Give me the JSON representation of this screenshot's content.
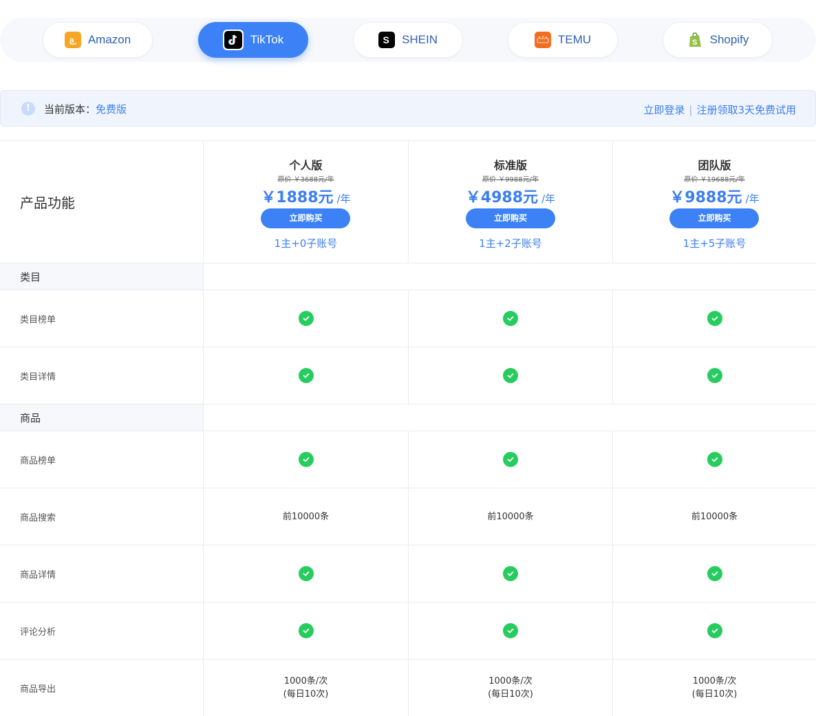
{
  "platform_tabs": [
    {
      "label": "Amazon",
      "active": false,
      "icon": "amazon-logo-icon",
      "color": "#f5a623"
    },
    {
      "label": "TikTok",
      "active": true,
      "icon": "tiktok-logo-icon",
      "color": "#000000"
    },
    {
      "label": "SHEIN",
      "active": false,
      "icon": "shein-logo-icon",
      "color": "#000000"
    },
    {
      "label": "TEMU",
      "active": false,
      "icon": "temu-logo-icon",
      "color": "#f36d21"
    },
    {
      "label": "Shopify",
      "active": false,
      "icon": "shopify-logo-icon",
      "color": "#95bf47"
    }
  ],
  "version_bar": {
    "icon": "info-icon",
    "prefix": "当前版本：",
    "current": "免费版",
    "login_link": "立即登录",
    "separator": "|",
    "trial_link": "注册领取3天免费试用"
  },
  "table": {
    "feature_header": "产品功能",
    "plans": [
      {
        "name": "个人版",
        "original": "原价 ￥3688元/年",
        "price": "￥1888元",
        "unit": "/年",
        "buy": "立即购买",
        "accounts": "1主+0子账号"
      },
      {
        "name": "标准版",
        "original": "原价 ￥9988元/年",
        "price": "￥4988元",
        "unit": "/年",
        "buy": "立即购买",
        "accounts": "1主+2子账号"
      },
      {
        "name": "团队版",
        "original": "原价 ￥19688元/年",
        "price": "￥9888元",
        "unit": "/年",
        "buy": "立即购买",
        "accounts": "1主+5子账号"
      }
    ],
    "sections": [
      {
        "title": "类目",
        "features": [
          {
            "name": "类目榜单",
            "values": [
              "check",
              "check",
              "check"
            ]
          },
          {
            "name": "类目详情",
            "values": [
              "check",
              "check",
              "check"
            ]
          }
        ]
      },
      {
        "title": "商品",
        "features": [
          {
            "name": "商品榜单",
            "values": [
              "check",
              "check",
              "check"
            ]
          },
          {
            "name": "商品搜索",
            "values": [
              "前10000条",
              "前10000条",
              "前10000条"
            ]
          },
          {
            "name": "商品详情",
            "values": [
              "check",
              "check",
              "check"
            ]
          },
          {
            "name": "评论分析",
            "values": [
              "check",
              "check",
              "check"
            ]
          },
          {
            "name": "商品导出",
            "values": [
              "1000条/次\n(每日10次)",
              "1000条/次\n(每日10次)",
              "1000条/次\n(每日10次)"
            ]
          }
        ]
      }
    ],
    "check_color": "#27cc5f",
    "accent_color": "#3c82f6"
  }
}
